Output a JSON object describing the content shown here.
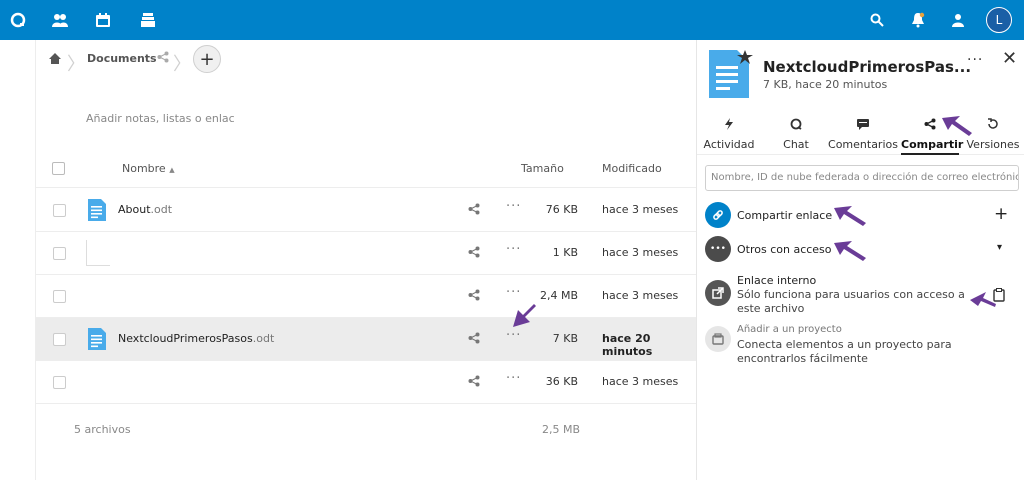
{
  "header": {
    "avatar_initial": "L",
    "accent": "#0082c9"
  },
  "breadcrumb": {
    "folder": "Documents"
  },
  "notes_placeholder": "Añadir notas, listas o enlac",
  "table": {
    "headers": {
      "name": "Nombre",
      "size": "Tamaño",
      "modified": "Modificado"
    },
    "rows": [
      {
        "base": "About",
        "ext": ".odt",
        "size": "76 KB",
        "modified": "hace 3 meses"
      },
      {
        "base": "",
        "ext": "",
        "size": "1 KB",
        "modified": "hace 3 meses"
      },
      {
        "base": "",
        "ext": "",
        "size": "2,4 MB",
        "modified": "hace 3 meses"
      },
      {
        "base": "NextcloudPrimerosPasos",
        "ext": ".odt",
        "size": "7 KB",
        "modified": "hace 20 minutos"
      },
      {
        "base": "",
        "ext": "",
        "size": "36 KB",
        "modified": "hace 3 meses"
      }
    ],
    "footer": {
      "count": "5 archivos",
      "total": "2,5 MB"
    },
    "more_label": "···"
  },
  "sidebar": {
    "title": "NextcloudPrimerosPas...",
    "subtitle": "7 KB, hace 20 minutos",
    "more_label": "···",
    "close_label": "✕",
    "tabs": [
      {
        "label": "Actividad"
      },
      {
        "label": "Chat"
      },
      {
        "label": "Comentarios"
      },
      {
        "label": "Compartir"
      },
      {
        "label": "Versiones"
      }
    ],
    "search_placeholder": "Nombre, ID de nube federada o dirección de correo electrónico ..",
    "share_link": {
      "label": "Compartir enlace",
      "action": "+"
    },
    "others": {
      "label": "Otros con acceso",
      "action": "▾"
    },
    "internal": {
      "label": "Enlace interno",
      "desc": "Sólo funciona para usuarios con acceso a este archivo"
    },
    "project": {
      "label": "Añadir a un proyecto",
      "desc": "Conecta elementos a un proyecto para encontrarlos fácilmente"
    }
  }
}
